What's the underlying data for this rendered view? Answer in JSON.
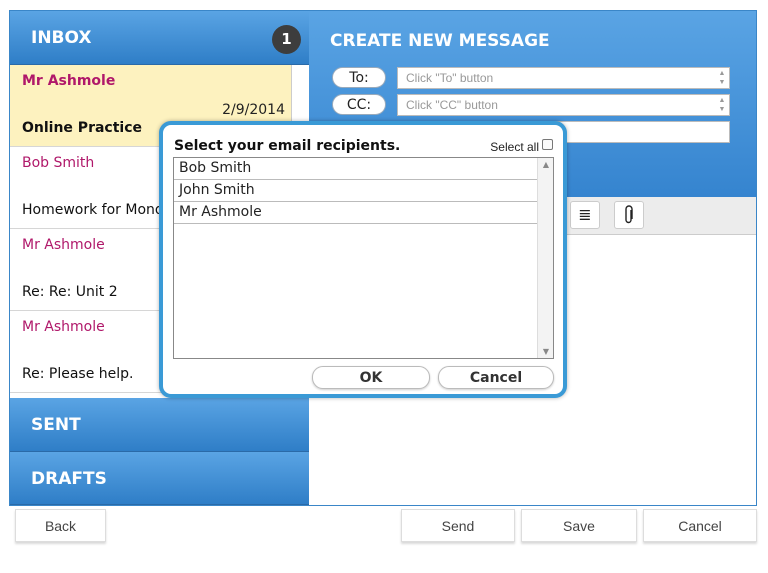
{
  "inbox": {
    "title": "INBOX",
    "unread_count": "1",
    "messages": [
      {
        "from": "Mr Ashmole",
        "date": "2/9/2014",
        "subject": "Online Practice"
      },
      {
        "from": "Bob Smith",
        "date": "",
        "subject": "Homework for Mond"
      },
      {
        "from": "Mr Ashmole",
        "date": "",
        "subject": "Re: Re: Unit 2"
      },
      {
        "from": "Mr Ashmole",
        "date": "",
        "subject": "Re: Please help."
      }
    ]
  },
  "sent": {
    "title": "SENT"
  },
  "drafts": {
    "title": "DRAFTS"
  },
  "compose": {
    "title": "CREATE NEW MESSAGE",
    "to_button": "To:",
    "cc_button": "CC:",
    "to_placeholder": "Click \"To\" button",
    "cc_placeholder": "Click \"CC\" button",
    "subject_value": ""
  },
  "toolbar": {
    "icons": [
      "align-justify-icon",
      "paperclip-icon"
    ]
  },
  "modal": {
    "title": "Select your email recipients.",
    "select_all_label": "Select all",
    "select_all_checked": false,
    "recipients": [
      "Bob Smith",
      "John Smith",
      "Mr Ashmole"
    ],
    "ok_label": "OK",
    "cancel_label": "Cancel"
  },
  "footer": {
    "back_label": "Back",
    "send_label": "Send",
    "save_label": "Save",
    "cancel_label": "Cancel"
  },
  "colors": {
    "header_blue": "#3a86c8",
    "selected_row": "#fdf2bf",
    "sender_magenta": "#b0186a",
    "badge_dark": "#3d3d3d"
  }
}
